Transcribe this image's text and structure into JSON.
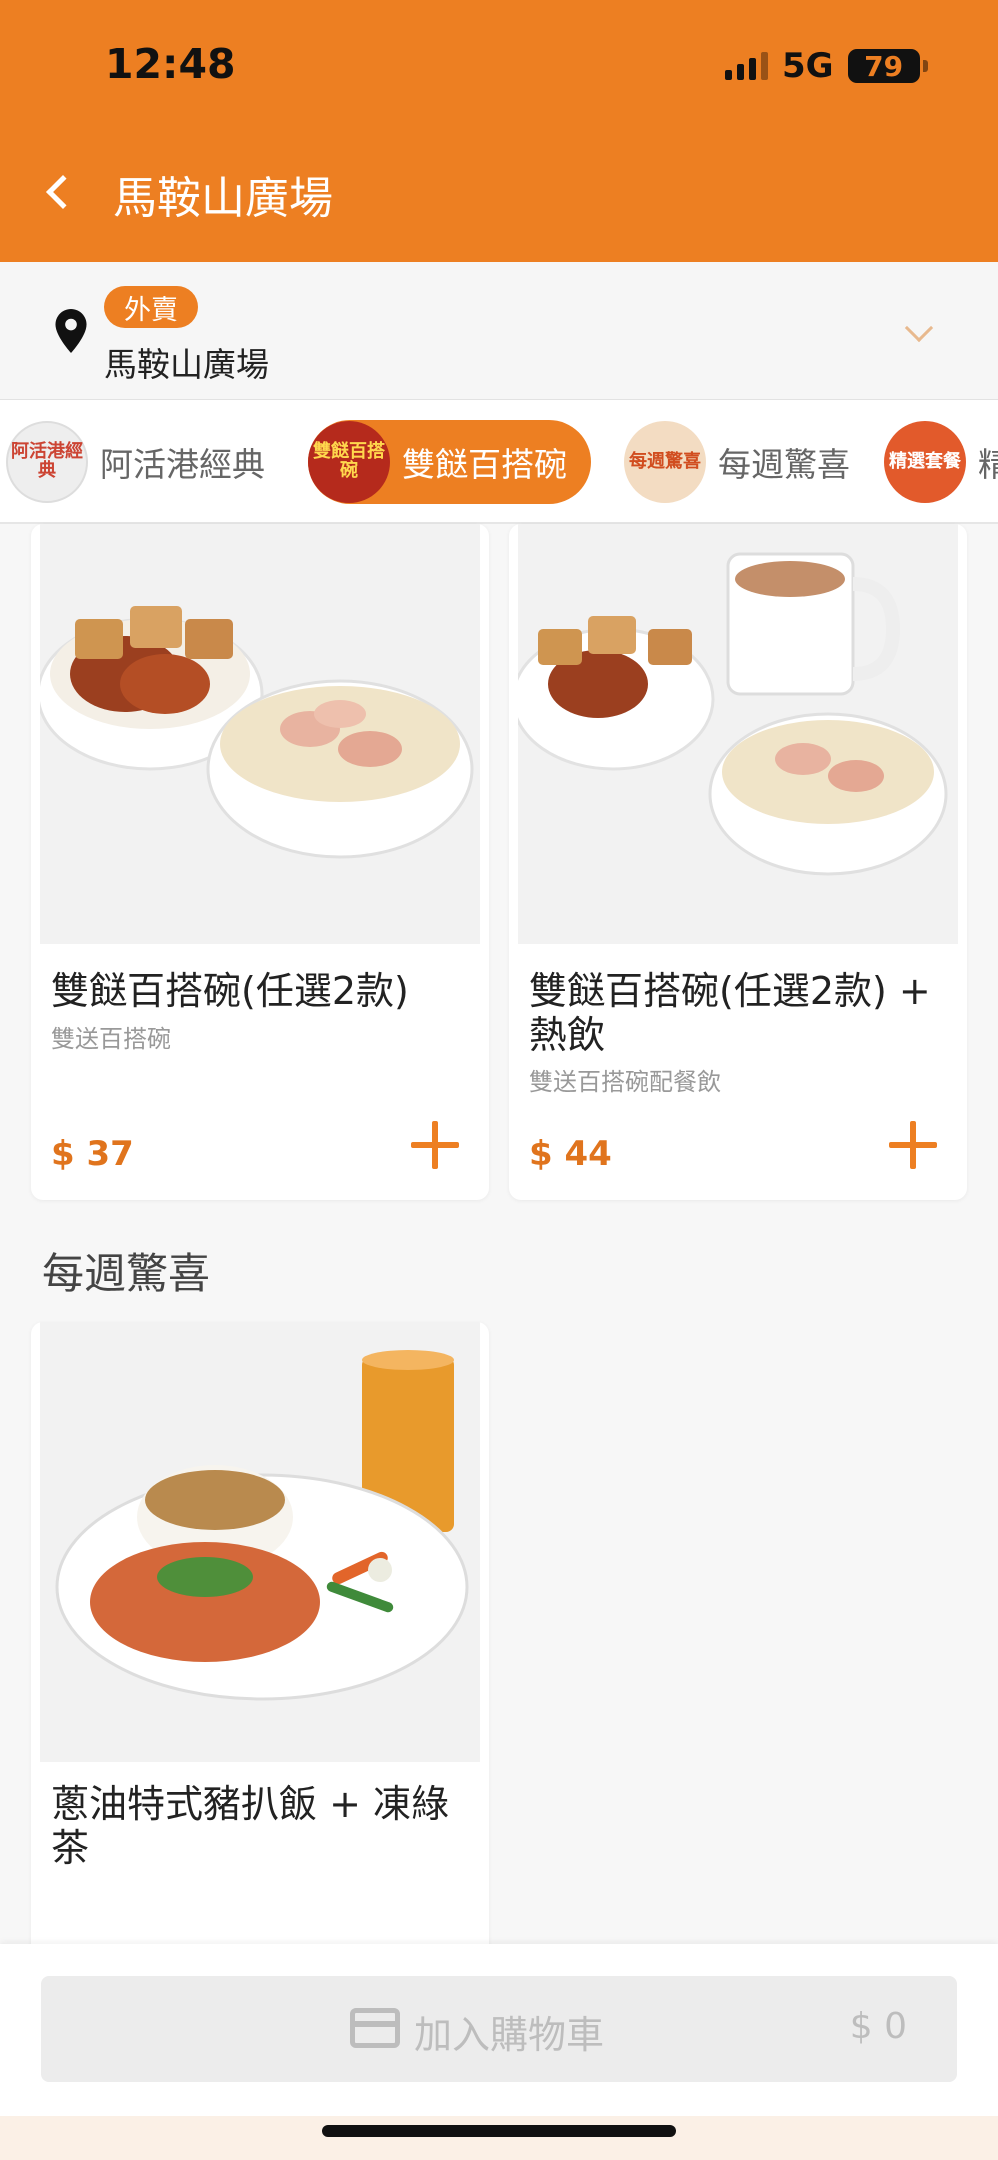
{
  "status_bar": {
    "time": "12:48",
    "network": "5G",
    "battery": "79"
  },
  "header": {
    "title": "馬鞍山廣場",
    "background_color": "#ed7f22"
  },
  "location": {
    "mode_badge": "外賣",
    "name": "馬鞍山廣場"
  },
  "tabs": [
    {
      "label": "阿活港經典",
      "icon_text": "阿活港經典",
      "active": false
    },
    {
      "label": "雙餸百搭碗",
      "icon_text": "雙餸百搭碗",
      "active": true
    },
    {
      "label": "每週驚喜",
      "icon_text": "每週驚喜",
      "active": false
    },
    {
      "label": "精",
      "icon_text": "精選套餐",
      "active": false
    }
  ],
  "products": [
    {
      "name": "雙餸百搭碗(任選2款)",
      "description": "雙送百搭碗",
      "price": "$ 37"
    },
    {
      "name": "雙餸百搭碗(任選2款) + 熱飲",
      "description": "雙送百搭碗配餐飲",
      "price": "$ 44"
    }
  ],
  "weekly_section": {
    "title": "每週驚喜",
    "products": [
      {
        "name": "蔥油特式豬扒飯 + 凍綠茶"
      }
    ]
  },
  "cart": {
    "label": "加入購物車",
    "total": "$ 0"
  },
  "colors": {
    "accent": "#ed7f22",
    "price": "#e0741d",
    "disabled": "#bdbdbd"
  }
}
